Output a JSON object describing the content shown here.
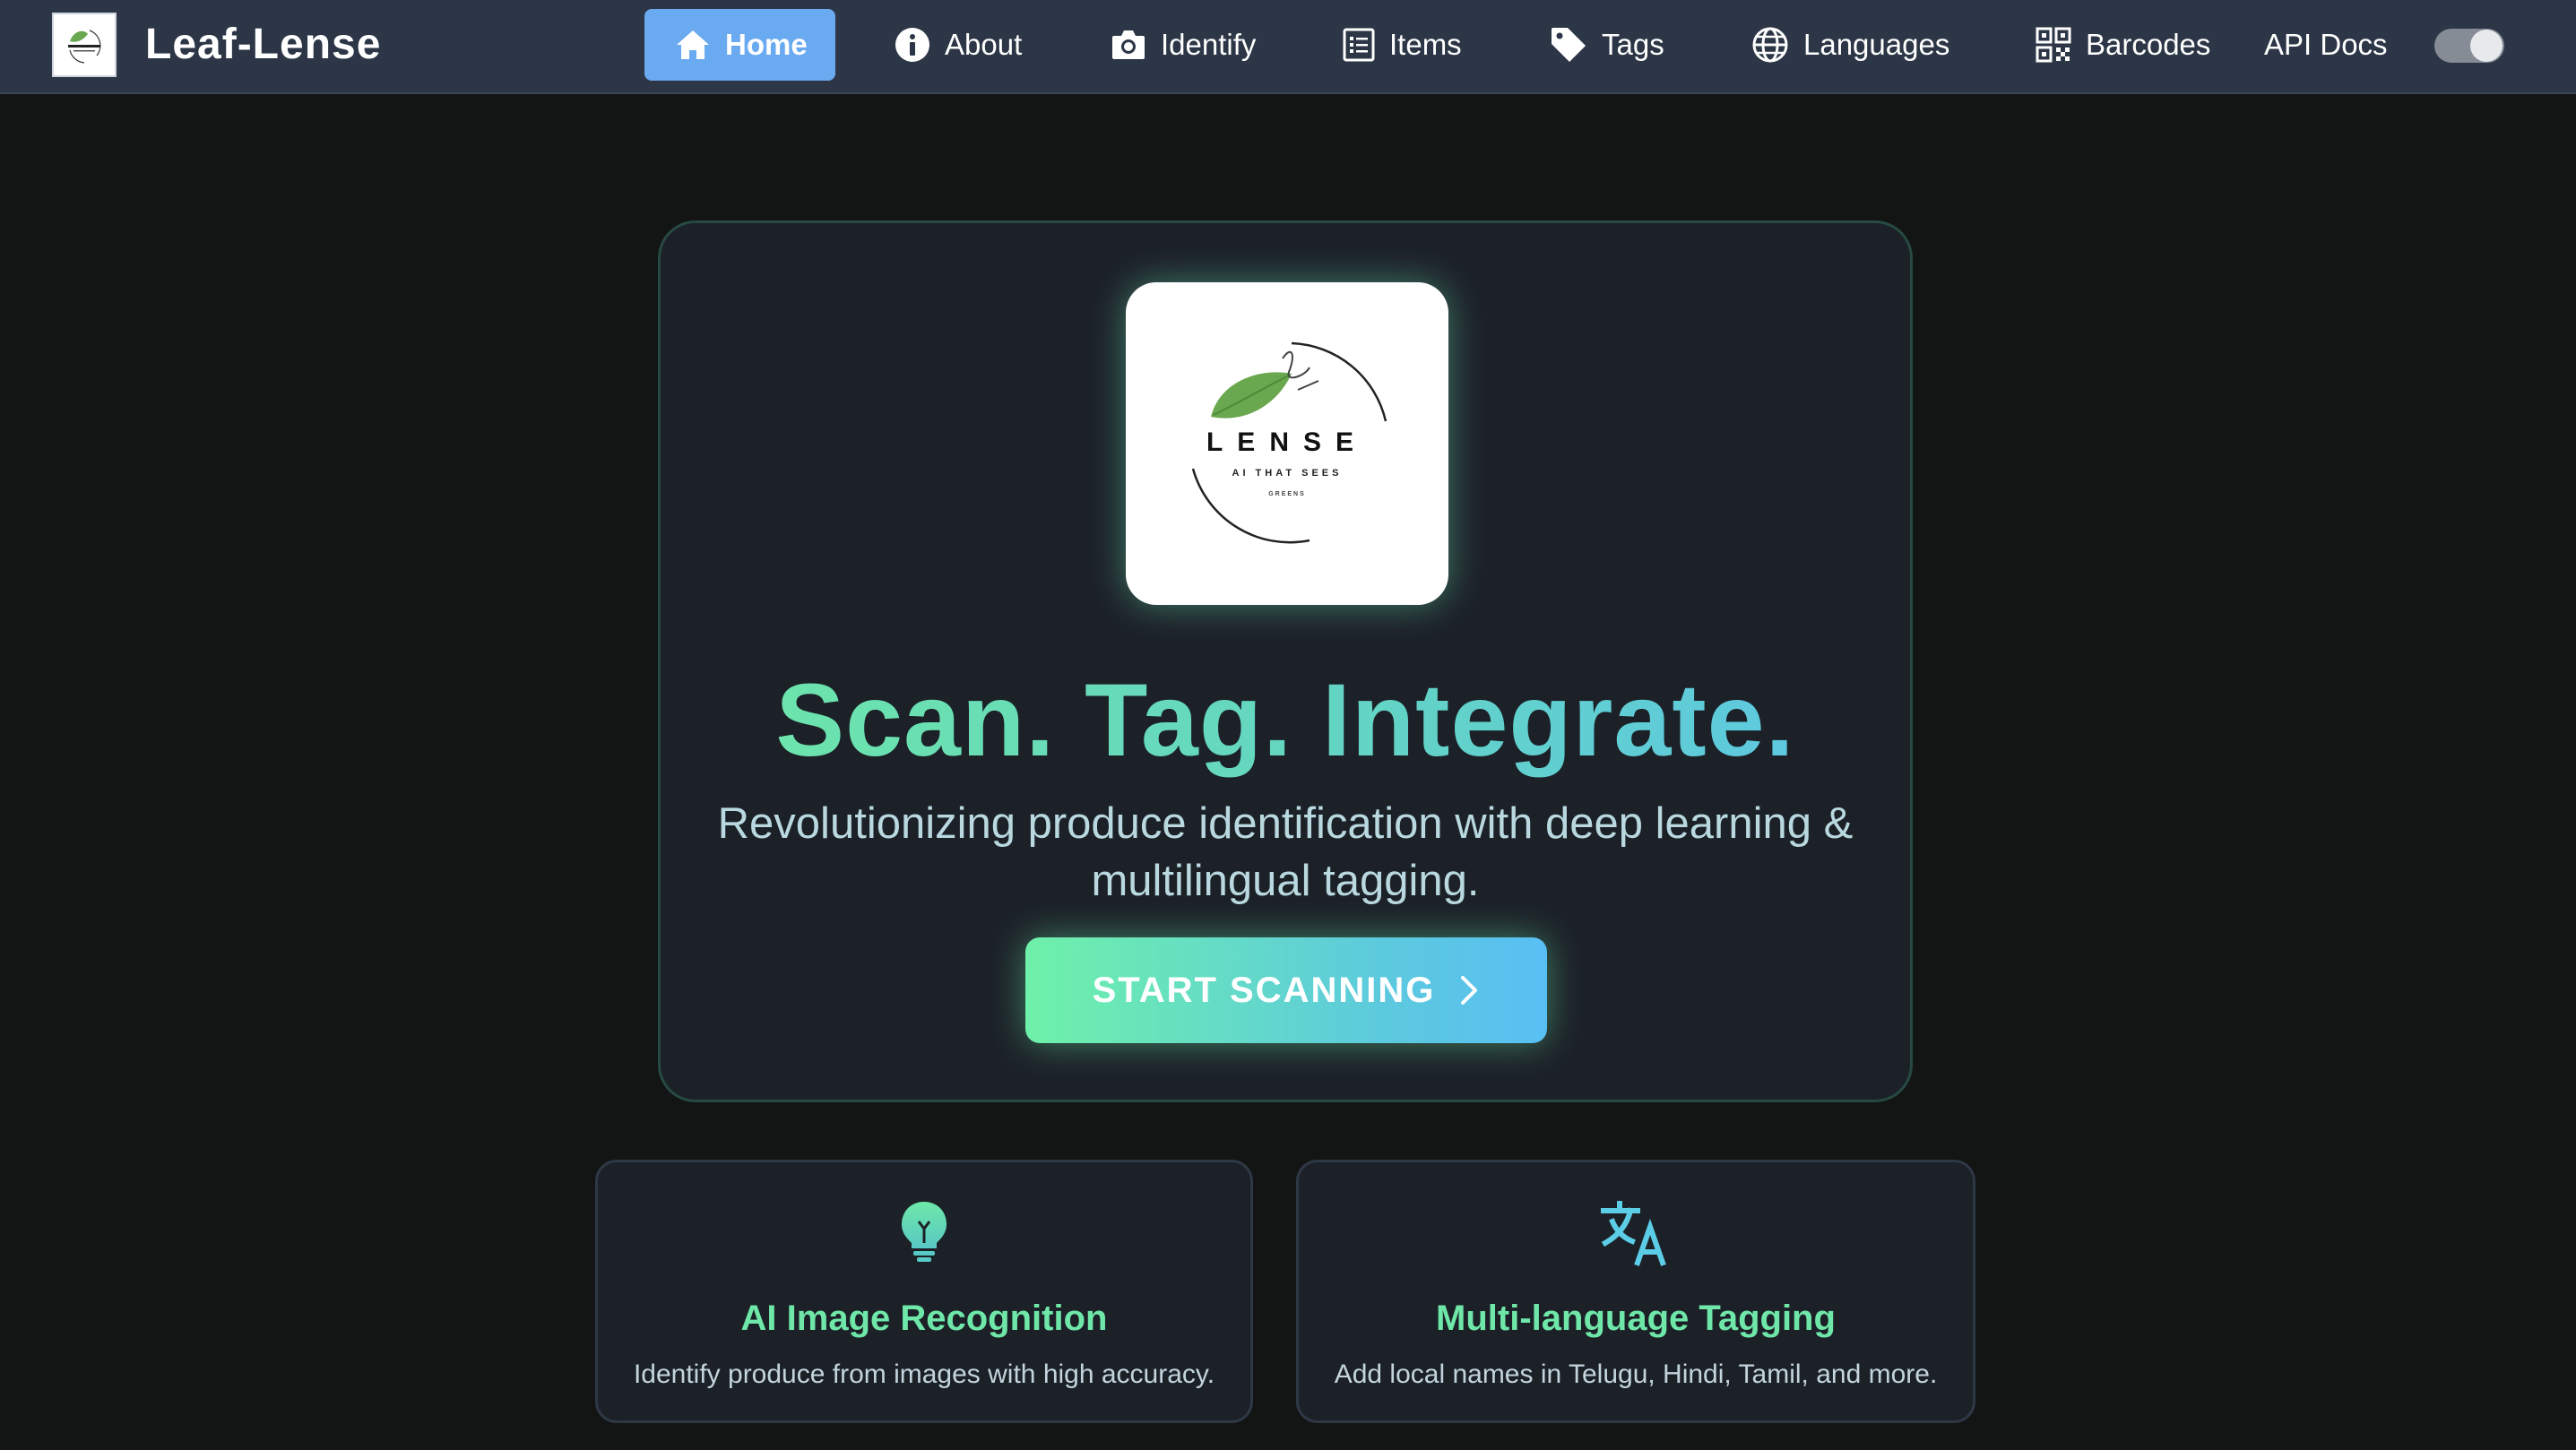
{
  "brand": {
    "name": "Leaf-Lense",
    "logo_word": "LENSE",
    "logo_tagline": "AI THAT SEES",
    "logo_subtagline": "GREENS"
  },
  "nav": {
    "home": "Home",
    "about": "About",
    "identify": "Identify",
    "items": "Items",
    "tags": "Tags",
    "languages": "Languages",
    "barcodes": "Barcodes",
    "api_docs": "API Docs",
    "active": "Home"
  },
  "hero": {
    "headline": "Scan. Tag. Integrate.",
    "subtitle": "Revolutionizing produce identification with deep learning & multilingual tagging.",
    "cta_label": "START SCANNING"
  },
  "features": [
    {
      "title": "AI Image Recognition",
      "description": "Identify produce from images with high accuracy.",
      "icon": "lightbulb-icon"
    },
    {
      "title": "Multi-language Tagging",
      "description": "Add local names in Telugu, Hindi, Tamil, and more.",
      "icon": "translate-icon"
    }
  ],
  "colors": {
    "navbar_bg": "#2c3646",
    "active_nav_bg": "#6aaaf0",
    "page_bg": "#131414",
    "card_bg": "#1c2128",
    "accent_green": "#6ee7a8",
    "accent_blue": "#58bff3"
  }
}
